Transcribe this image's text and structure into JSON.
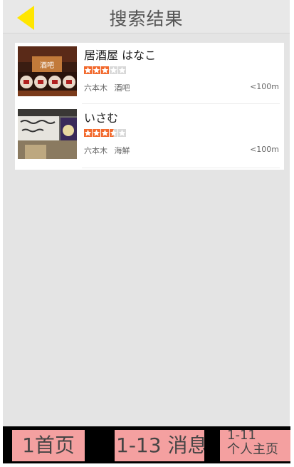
{
  "header": {
    "title": "搜索结果",
    "back_icon": "back-arrow-icon",
    "back_color": "#ffe600"
  },
  "results": [
    {
      "name": "居酒屋 はなこ",
      "rating": 3,
      "max_rating": 5,
      "area": "六本木",
      "category": "酒吧",
      "distance": "<100m",
      "thumb_sign": "酒吧"
    },
    {
      "name": "いさむ",
      "rating": 3.5,
      "max_rating": 5,
      "area": "六本木",
      "category": "海鮮",
      "distance": "<100m",
      "thumb_sign": ""
    }
  ],
  "tabbar": {
    "home_label": "1首页",
    "messages_label": "1-13 消息",
    "profile_label_line1": "1-11",
    "profile_label_line2": "个人主页"
  },
  "colors": {
    "star_on": "#f26a2e",
    "star_off": "#d8d8d8",
    "tab_bg": "#f4a0a0"
  }
}
